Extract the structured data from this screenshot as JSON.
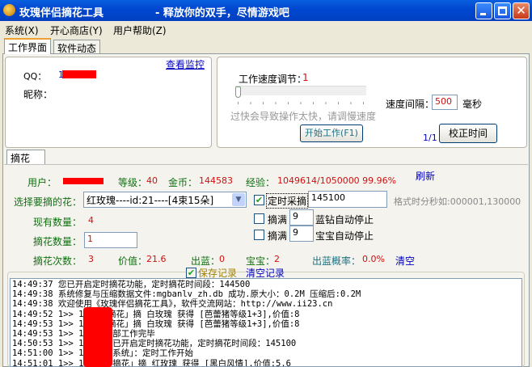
{
  "window": {
    "title": "玫瑰伴侣摘花工具",
    "subtitle": "- 释放你的双手，尽情游戏吧"
  },
  "menu": [
    "系统(X)",
    "开心商店(Y)",
    "用户帮助(Z)"
  ],
  "tabs": [
    "工作界面",
    "软件动态"
  ],
  "account": {
    "qq_label": "QQ：",
    "qq_value": "1",
    "nick_label": "昵称：",
    "monitor_link": "查看监控"
  },
  "speed": {
    "label": "工作速度调节：",
    "value": "1",
    "slider_fraction": 0,
    "warning": "过快会导致操作太快，请调慢速度",
    "interval_label": "速度间隔：",
    "interval_value": "500",
    "interval_unit": "毫秒",
    "start_button": "开始工作(F1)",
    "page": "1/1",
    "sync_button": "校正时间"
  },
  "subtab": "摘花",
  "stats": {
    "user_label": "用户：",
    "level_label": "等级：",
    "level": "40",
    "gold_label": "金币：",
    "gold": "144583",
    "exp_label": "经验：",
    "exp": "1049614/1050000 99.96%",
    "refresh": "刷新"
  },
  "flower": {
    "label": "选择要摘的花：",
    "selected": "红玫瑰----id:21----[4束15朵]",
    "timed_label": "定时采摘",
    "timed_checked": true,
    "timed_value": "145100",
    "format_hint": "格式时分秒如:000001,130000",
    "stock_label": "现有数量：",
    "stock": "4",
    "pick_label": "摘花数量：",
    "pick_value": "1",
    "full1_label": "摘满",
    "full1_value": "9",
    "full1_suffix": "蓝钻自动停止",
    "full2_label": "摘满",
    "full2_value": "9",
    "full2_suffix": "宝宝自动停止"
  },
  "summary": {
    "count_label": "摘花次数：",
    "count": "3",
    "value_label": "价值：",
    "value": "21.6",
    "blue_label": "出蓝：",
    "blue": "0",
    "baby_label": "宝宝：",
    "baby": "2",
    "rate_label": "出蓝概率：",
    "rate": "0.0%",
    "clear": "清空"
  },
  "log_options": {
    "save_label": "保存记录",
    "save_checked": true,
    "clear_label": "清空记录"
  },
  "log": [
    "14:49:37 您已开启定时摘花功能，定时摘花时间段：144500",
    "14:49:38 系统修复与压缩数据文件:mgbanlv_zh.db 成功.原大小：0.2M 压缩后:0.2M",
    "14:49:38 欢迎使用《玫瑰伴侣摘花工具》，软件交流网站：http://www.ii23.cn",
    "14:49:52 1>> 1        : 「摘花」摘 白玫瑰 获得 [芭蕾猪等级1+3],价值:8",
    "14:49:53 1>> 1        : 「摘花」摘 白玫瑰 获得 [芭蕾猪等级1+3],价值:8",
    "14:49:53 1>> 19       : 全部工作完毕",
    "14:50:53 1>> 19       : 您已开启定时摘花功能，定时摘花时间段：145100",
    "14:51:00 1>> 19       : 「系统」：定时工作开始",
    "14:51:01 1>> 19       : 「摘花」摘 红玫瑰 获得 [黑白风情],价值:5.6"
  ]
}
